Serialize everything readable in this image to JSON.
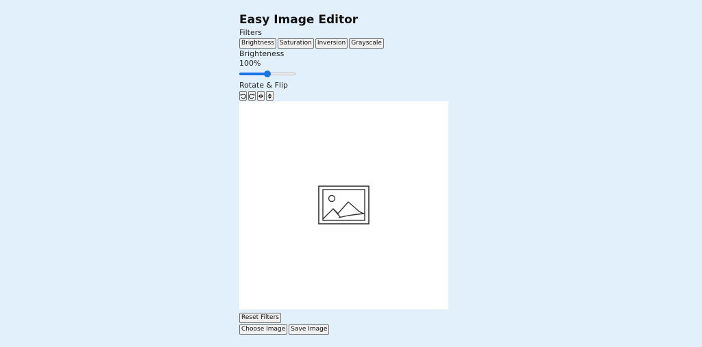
{
  "app": {
    "title": "Easy Image Editor"
  },
  "filters": {
    "heading": "Filters",
    "buttons": [
      "Brightness",
      "Saturation",
      "Inversion",
      "Grayscale"
    ],
    "active_name": "Brighteness",
    "value_text": "100%",
    "slider_value": 0.5,
    "accent_color": "#1a73e8"
  },
  "rotate": {
    "heading": "Rotate & Flip",
    "icons": [
      "rotate-left-icon",
      "rotate-right-icon",
      "flip-horizontal-icon",
      "flip-vertical-icon"
    ]
  },
  "preview": {
    "icon": "image-placeholder-icon"
  },
  "actions": {
    "reset_label": "Reset Filters",
    "choose_label": "Choose Image",
    "save_label": "Save Image"
  }
}
